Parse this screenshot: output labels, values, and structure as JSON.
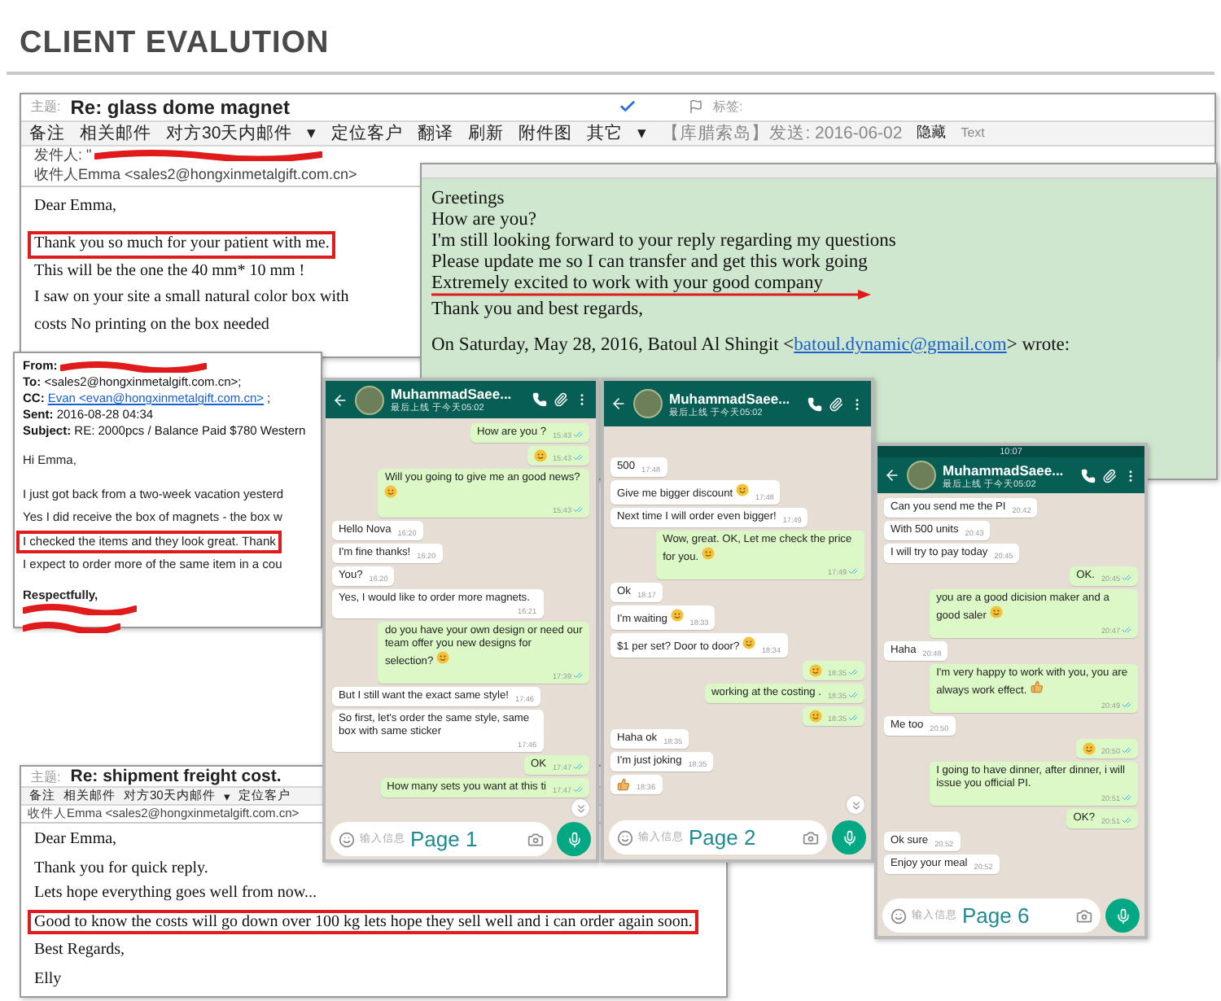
{
  "title": "CLIENT EVALUTION",
  "email_glass": {
    "subject_label": "主题:",
    "subject": "Re: glass dome magnet",
    "tag_label": "标签:",
    "toolbar": [
      "备注",
      "相关邮件",
      "对方30天内邮件",
      "▾",
      "定位客户",
      "翻译",
      "刷新",
      "附件图",
      "其它",
      "▾"
    ],
    "sent_info": "【库腊索岛】发送: 2016-06-02",
    "hide": "隐藏",
    "text_button": "Text",
    "from_label": "发件人: \"",
    "to": "收件人Emma <sales2@hongxinmetalgift.com.cn>",
    "body": [
      {
        "lines": [
          {
            "text": "Dear Emma,",
            "highlighted": false
          }
        ]
      },
      {
        "lines": [
          {
            "text": "Thank you so much for your patient with me.",
            "highlighted": true
          },
          {
            "text": "This will be the one the 40 mm* 10 mm !",
            "highlighted": false
          },
          {
            "text": "I saw on your site a small natural color box with",
            "highlighted": false
          },
          {
            "text": "costs No printing on the box needed",
            "highlighted": false
          }
        ]
      }
    ]
  },
  "email_green": {
    "lines": [
      {
        "text": "Greetings",
        "arrow": false
      },
      {
        "text": "How are you?",
        "arrow": false
      },
      {
        "text": "I'm still looking forward to your reply regarding my questions",
        "arrow": false
      },
      {
        "text": "Please update me so I can transfer and get this work going",
        "arrow": false
      },
      {
        "text": "Extremely excited to work with your good company",
        "arrow": true
      },
      {
        "text": "Thank you and best regards,",
        "arrow": false
      }
    ],
    "quote": {
      "prefix": "On Saturday, May 28, 2016, Batoul Al Shingit <",
      "link": "batoul.dynamic@gmail.com",
      "suffix": "> wrote:"
    }
  },
  "email_vacation": {
    "from_label": "From:",
    "headers": [
      {
        "kind": "plain",
        "text": "**To:** <sales2@hongxinmetalgift.com.cn>;"
      },
      {
        "kind": "link",
        "label": "CC:",
        "link": "Evan <evan@hongxinmetalgift.com.cn>",
        "suffix": ";"
      },
      {
        "kind": "plain",
        "text": "**Sent:** 2016-08-28 04:34"
      },
      {
        "kind": "plain",
        "text": "**Subject:** RE: 2000pcs / Balance Paid $780 Western"
      }
    ],
    "body": [
      {
        "lines": [
          {
            "text": "Hi Emma,",
            "highlighted": false
          }
        ]
      },
      {
        "lines": [
          {
            "text": "I just got back from a two-week vacation yesterd",
            "highlighted": false
          },
          {
            "text": "Yes I did receive the box of magnets - the box w",
            "highlighted": false
          },
          {
            "text": "I checked the items and they look great.  Thank",
            "highlighted": true
          },
          {
            "text": "I expect to order more of the same item in a cou",
            "highlighted": false
          }
        ]
      }
    ],
    "signoff": "Respectfully,"
  },
  "email_freight": {
    "subject_label": "主题:",
    "subject": "Re: shipment freight cost.",
    "toolbar": [
      "备注",
      "相关邮件",
      "对方30天内邮件",
      "▾",
      "定位客户"
    ],
    "to": "收件人Emma <sales2@hongxinmetalgift.com.cn>",
    "body": [
      {
        "lines": [
          {
            "text": "Dear Emma,",
            "highlighted": false
          }
        ]
      },
      {
        "lines": [
          {
            "text": "Thank you for quick reply.",
            "highlighted": false
          },
          {
            "text": "Lets hope everything goes well from now...",
            "highlighted": false
          }
        ]
      },
      {
        "lines": [
          {
            "text": "Good to know the costs will go down over 100 kg lets hope they sell well and i can order again soon.",
            "highlighted": true
          }
        ]
      },
      {
        "lines": [
          {
            "text": "Best Regards,",
            "highlighted": false
          }
        ]
      },
      {
        "lines": [
          {
            "text": "Elly",
            "highlighted": false
          }
        ]
      }
    ]
  },
  "phones": [
    {
      "name": "MuhammadSaee...",
      "last_seen": "最后上线 于今天05:02",
      "placeholder": "输入信息",
      "page_label": "Page 1",
      "scroll_down_button": true,
      "messages": [
        {
          "outgoing": true,
          "kind": "text",
          "text": "How are you ?",
          "time": "15:43"
        },
        {
          "outgoing": true,
          "kind": "emoji",
          "emoji": {
            "kind": "smile"
          },
          "time": "15:43"
        },
        {
          "outgoing": true,
          "kind": "text",
          "text": "Will you going to give me an good news?",
          "emoji": {
            "kind": "smile"
          },
          "time": "15:43"
        },
        {
          "outgoing": false,
          "kind": "text",
          "text": "Hello Nova",
          "time": "16:20"
        },
        {
          "outgoing": false,
          "kind": "text",
          "text": "I'm fine thanks!",
          "time": "16:20"
        },
        {
          "outgoing": false,
          "kind": "text",
          "text": "You?",
          "time": "16:20"
        },
        {
          "outgoing": false,
          "kind": "text",
          "text": "Yes, I would like to order more magnets.",
          "time": "16:21"
        },
        {
          "outgoing": true,
          "kind": "text",
          "text": "do you have your own design or need our team offer you new designs for selection?",
          "emoji": {
            "kind": "smile"
          },
          "time": "17:39"
        },
        {
          "outgoing": false,
          "kind": "text",
          "text": "But I still want the exact same style!",
          "time": "17:46"
        },
        {
          "outgoing": false,
          "kind": "text",
          "text": "So first, let's order the same style, same box with same sticker",
          "time": "17:46"
        },
        {
          "outgoing": true,
          "kind": "text",
          "text": "OK",
          "time": "17:47"
        },
        {
          "outgoing": true,
          "kind": "text",
          "text": "How many sets you want at this ti",
          "time": "17:47"
        }
      ]
    },
    {
      "name": "MuhammadSaee...",
      "last_seen": "最后上线 于今天05:02",
      "placeholder": "输入信息",
      "page_label": "Page 2",
      "scroll_down_button": true,
      "messages": [
        {
          "outgoing": false,
          "kind": "text",
          "text": "500",
          "time": "17:48"
        },
        {
          "outgoing": false,
          "kind": "text",
          "text": "Give me bigger discount",
          "emoji": {
            "kind": "smile"
          },
          "time": "17:48"
        },
        {
          "outgoing": false,
          "kind": "text",
          "text": "Next time I will order even bigger!",
          "time": "17:49"
        },
        {
          "outgoing": true,
          "kind": "text",
          "text": "Wow, great. OK,  Let me check the price for you.",
          "emoji": {
            "kind": "smile"
          },
          "time": "17:49"
        },
        {
          "outgoing": false,
          "kind": "text",
          "text": "Ok",
          "time": "18:17"
        },
        {
          "outgoing": false,
          "kind": "text",
          "text": "I'm waiting",
          "emoji": {
            "kind": "smile"
          },
          "time": "18:33"
        },
        {
          "outgoing": false,
          "kind": "text",
          "text": "$1 per set? Door to door?",
          "emoji": {
            "kind": "smile"
          },
          "time": "18:34"
        },
        {
          "outgoing": true,
          "kind": "emoji",
          "emoji": {
            "kind": "smile"
          },
          "time": "18:35"
        },
        {
          "outgoing": true,
          "kind": "text",
          "text": "working at the costing .",
          "time": "18:35"
        },
        {
          "outgoing": true,
          "kind": "emoji",
          "emoji": {
            "kind": "smile"
          },
          "time": "18:35"
        },
        {
          "outgoing": false,
          "kind": "text",
          "text": "Haha ok",
          "time": "18:35"
        },
        {
          "outgoing": false,
          "kind": "text",
          "text": "I'm just joking",
          "time": "18:35"
        },
        {
          "outgoing": false,
          "kind": "emoji",
          "emoji": {
            "kind": "thumbs"
          },
          "time": "18:36"
        }
      ]
    },
    {
      "name": "MuhammadSaee...",
      "last_seen": "最后上线 于今天05:02",
      "placeholder": "输入信息",
      "page_label": "Page 6",
      "scroll_down_button": false,
      "status_bar": {
        "time": "10:07"
      },
      "messages": [
        {
          "outgoing": false,
          "kind": "text",
          "text": "Can you send me the PI",
          "time": "20:42"
        },
        {
          "outgoing": false,
          "kind": "text",
          "text": "With 500 units",
          "time": "20:43"
        },
        {
          "outgoing": false,
          "kind": "text",
          "text": "I will try to pay today",
          "time": "20:45"
        },
        {
          "outgoing": true,
          "kind": "text",
          "text": "OK.",
          "time": "20:45"
        },
        {
          "outgoing": true,
          "kind": "text",
          "text": "you are a good dicision maker and a good saler",
          "emoji": {
            "kind": "smile"
          },
          "time": "20:47"
        },
        {
          "outgoing": false,
          "kind": "text",
          "text": "Haha",
          "time": "20:48"
        },
        {
          "outgoing": true,
          "kind": "text",
          "text": "I'm very happy to work with you, you are always work effect.",
          "emoji": {
            "kind": "thumbs"
          },
          "time": "20:49"
        },
        {
          "outgoing": false,
          "kind": "text",
          "text": "Me too",
          "time": "20:50"
        },
        {
          "outgoing": true,
          "kind": "emoji",
          "emoji": {
            "kind": "smile"
          },
          "time": "20:50"
        },
        {
          "outgoing": true,
          "kind": "text",
          "text": "I going to have dinner, after dinner, i will issue you official PI.",
          "time": "20:51"
        },
        {
          "outgoing": true,
          "kind": "text",
          "text": "OK?",
          "time": "20:51"
        },
        {
          "outgoing": false,
          "kind": "text",
          "text": "Ok sure",
          "time": "20:52"
        },
        {
          "outgoing": false,
          "kind": "text",
          "text": "Enjoy your meal",
          "time": "20:52"
        }
      ]
    }
  ]
}
